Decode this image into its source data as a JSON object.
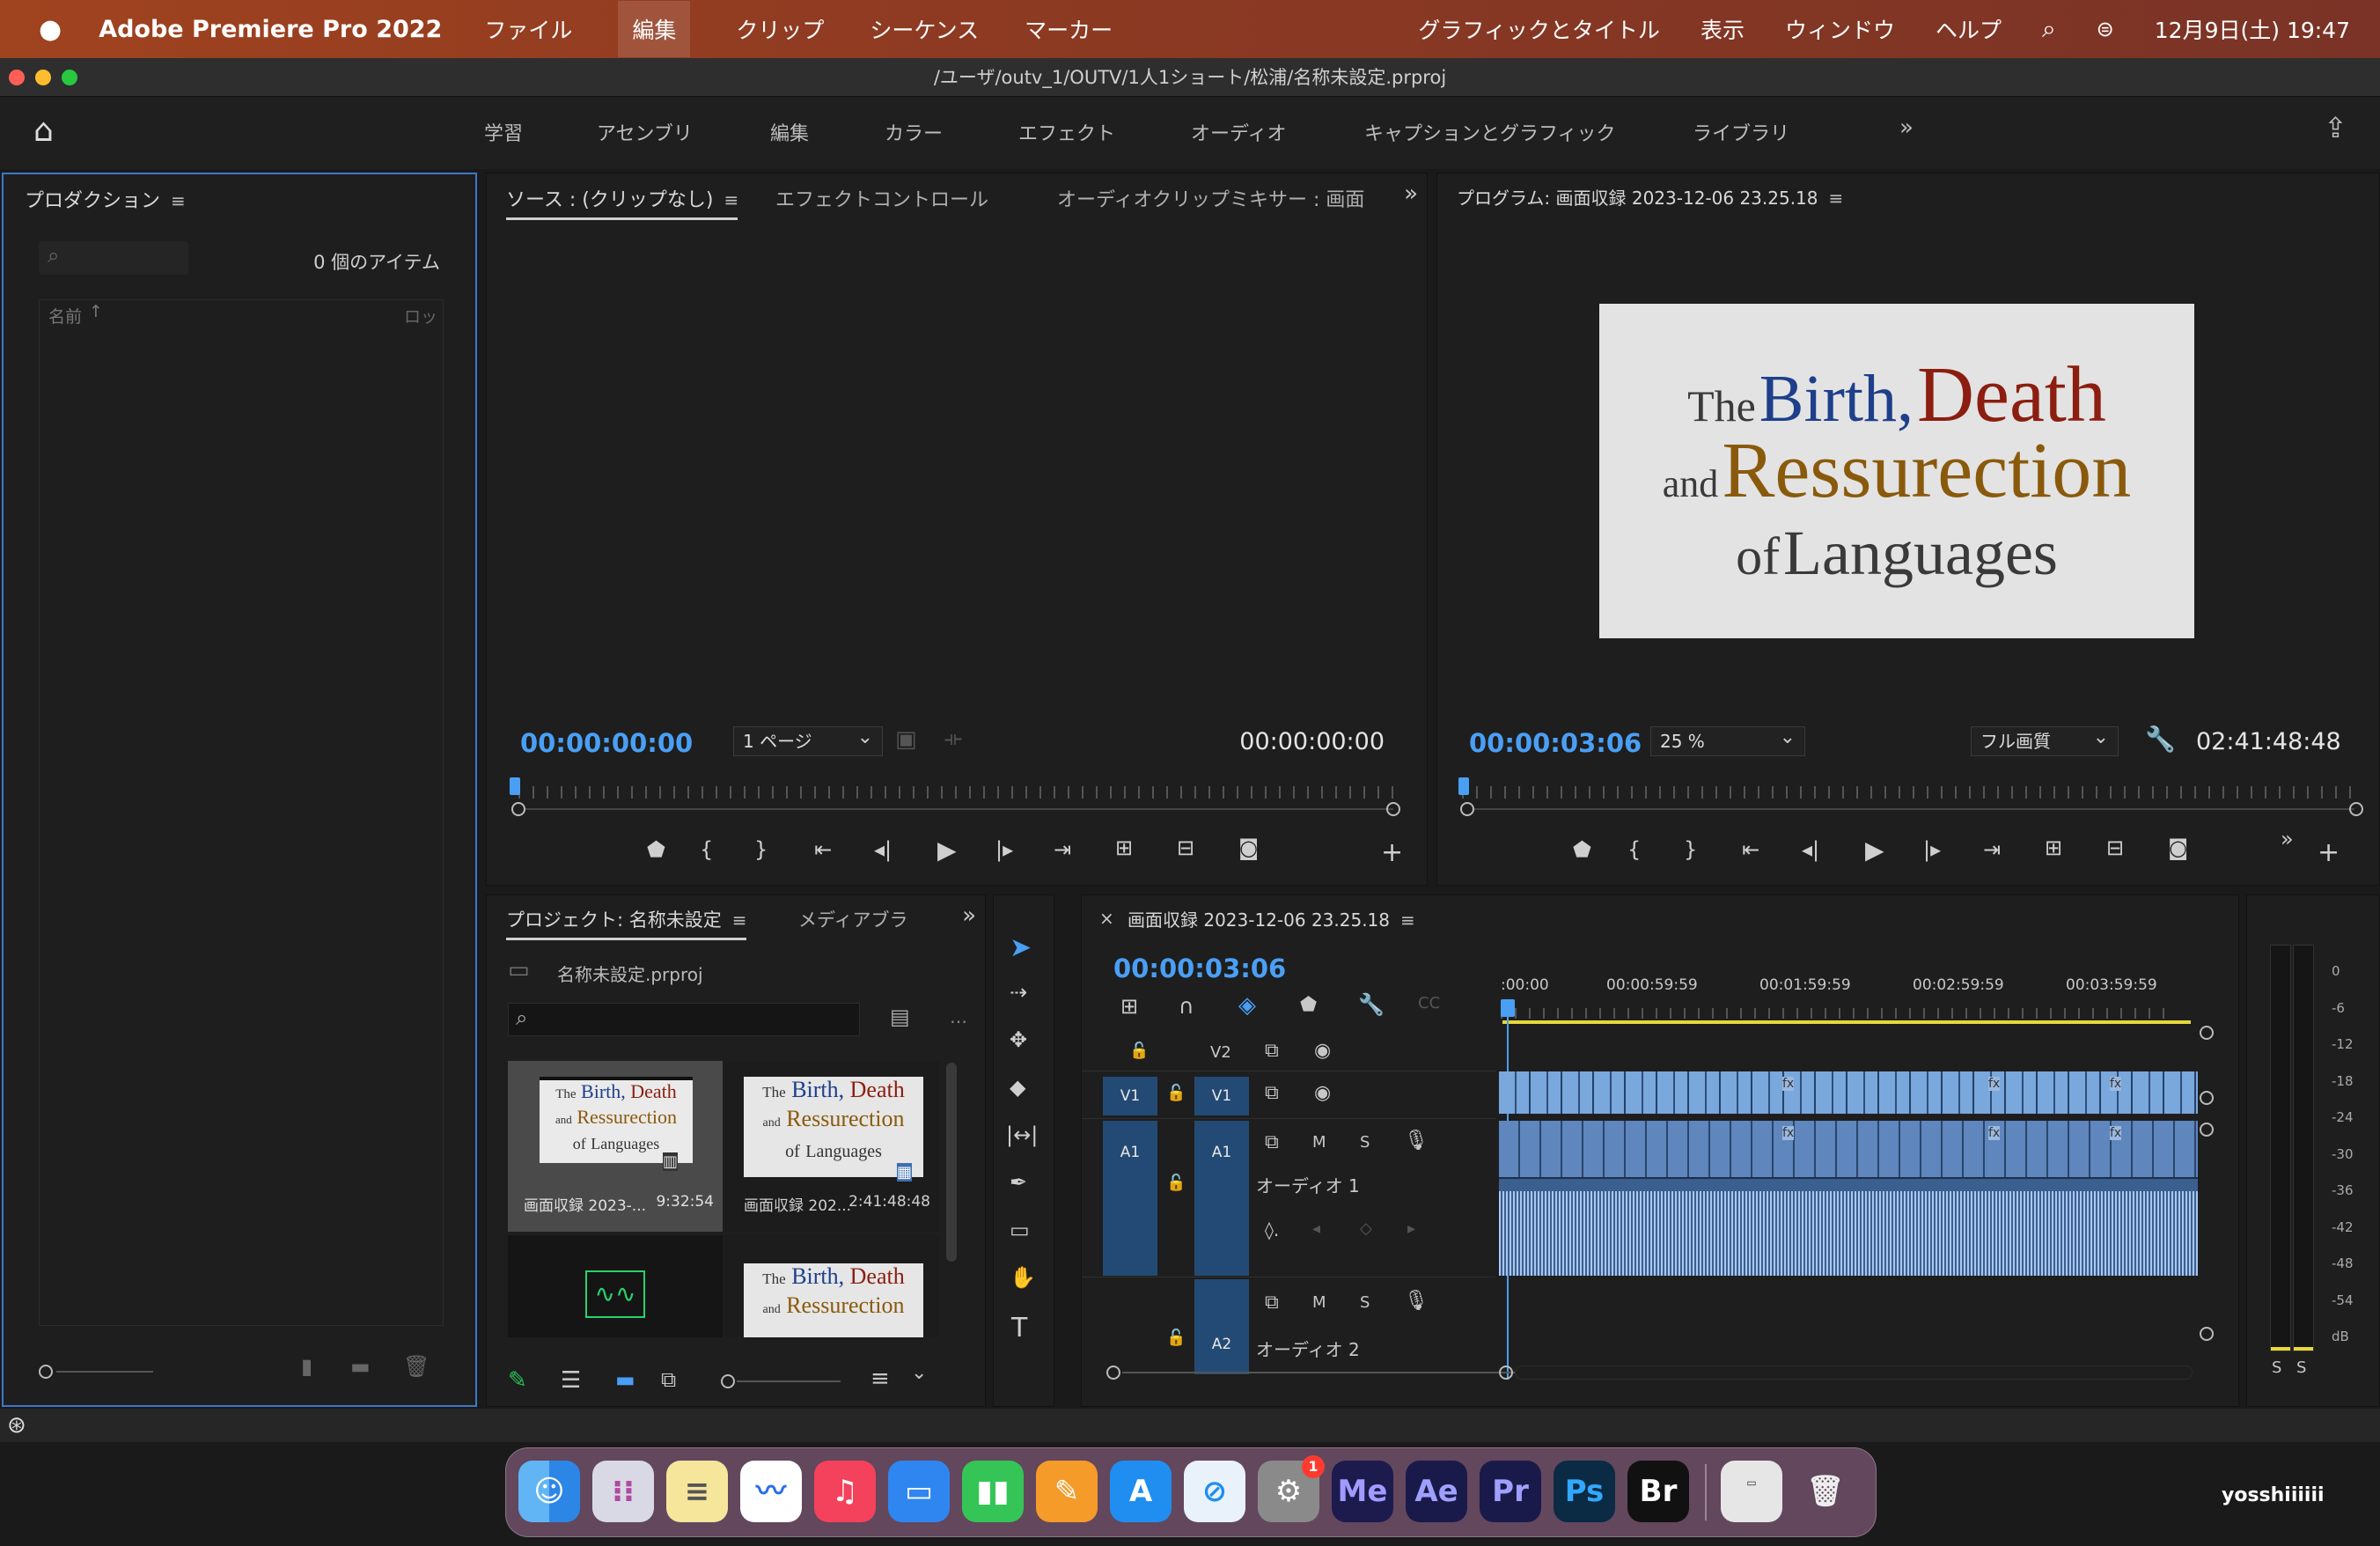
{
  "menubar": {
    "app_name": "Adobe Premiere Pro 2022",
    "items": [
      "ファイル",
      "編集",
      "クリップ",
      "シーケンス",
      "マーカー"
    ],
    "right_items": [
      "グラフィックとタイトル",
      "表示",
      "ウィンドウ",
      "ヘルプ"
    ],
    "datetime": "12月9日(土) 19:47"
  },
  "window": {
    "path": "/ユーザ/outv_1/OUTV/1人1ショート/松浦/名称未設定.prproj"
  },
  "workspaces": [
    "学習",
    "アセンブリ",
    "編集",
    "カラー",
    "エフェクト",
    "オーディオ",
    "キャプションとグラフィック",
    "ライブラリ"
  ],
  "production_panel": {
    "title": "プロダクション",
    "item_count": "0 個のアイテム",
    "col_name": "名前",
    "col_lock": "ロッ"
  },
  "source_panel": {
    "tabs": [
      "ソース : (クリップなし)",
      "エフェクトコントロール",
      "オーディオクリップミキサー : 画面"
    ],
    "timecode_in": "00:00:00:00",
    "page_select": "1 ページ",
    "timecode_out": "00:00:00:00"
  },
  "program_panel": {
    "title": "プログラム: 画面収録 2023-12-06 23.25.18",
    "frame": {
      "w1": "The",
      "w2": "Birth,",
      "w3": "Death",
      "w4": "and",
      "w5": "Ressurection",
      "w6": "of",
      "w7": "Languages"
    },
    "timecode": "00:00:03:06",
    "zoom": "25 %",
    "quality": "フル画質",
    "duration": "02:41:48:48"
  },
  "project_panel": {
    "tabs": [
      "プロジェクト: 名称未設定",
      "メディアブラ"
    ],
    "file": "名称未設定.prproj",
    "items": [
      {
        "name": "画面収録 2023-...",
        "duration": "9:32:54"
      },
      {
        "name": "画面収録 202...",
        "duration": "2:41:48:48"
      }
    ]
  },
  "timeline": {
    "title": "画面収録 2023-12-06 23.25.18",
    "timecode": "00:00:03:06",
    "ticks": [
      ":00:00",
      "00:00:59:59",
      "00:01:59:59",
      "00:02:59:59",
      "00:03:59:59"
    ],
    "tracks": {
      "v2": "V2",
      "v1": "V1",
      "a1": "A1",
      "a2": "A2",
      "audio1": "オーディオ 1",
      "audio2": "オーディオ 2",
      "m": "M",
      "s": "S"
    }
  },
  "meter": {
    "labels": [
      "0",
      "-6",
      "-12",
      "-18",
      "-24",
      "-30",
      "-36",
      "-42",
      "-48",
      "-54",
      "dB"
    ],
    "solo": [
      "S",
      "S"
    ]
  },
  "dock": {
    "apps": [
      "Me",
      "Ae",
      "Pr",
      "Ps",
      "Br"
    ],
    "badge": "1",
    "user": "yosshiiiiii"
  }
}
